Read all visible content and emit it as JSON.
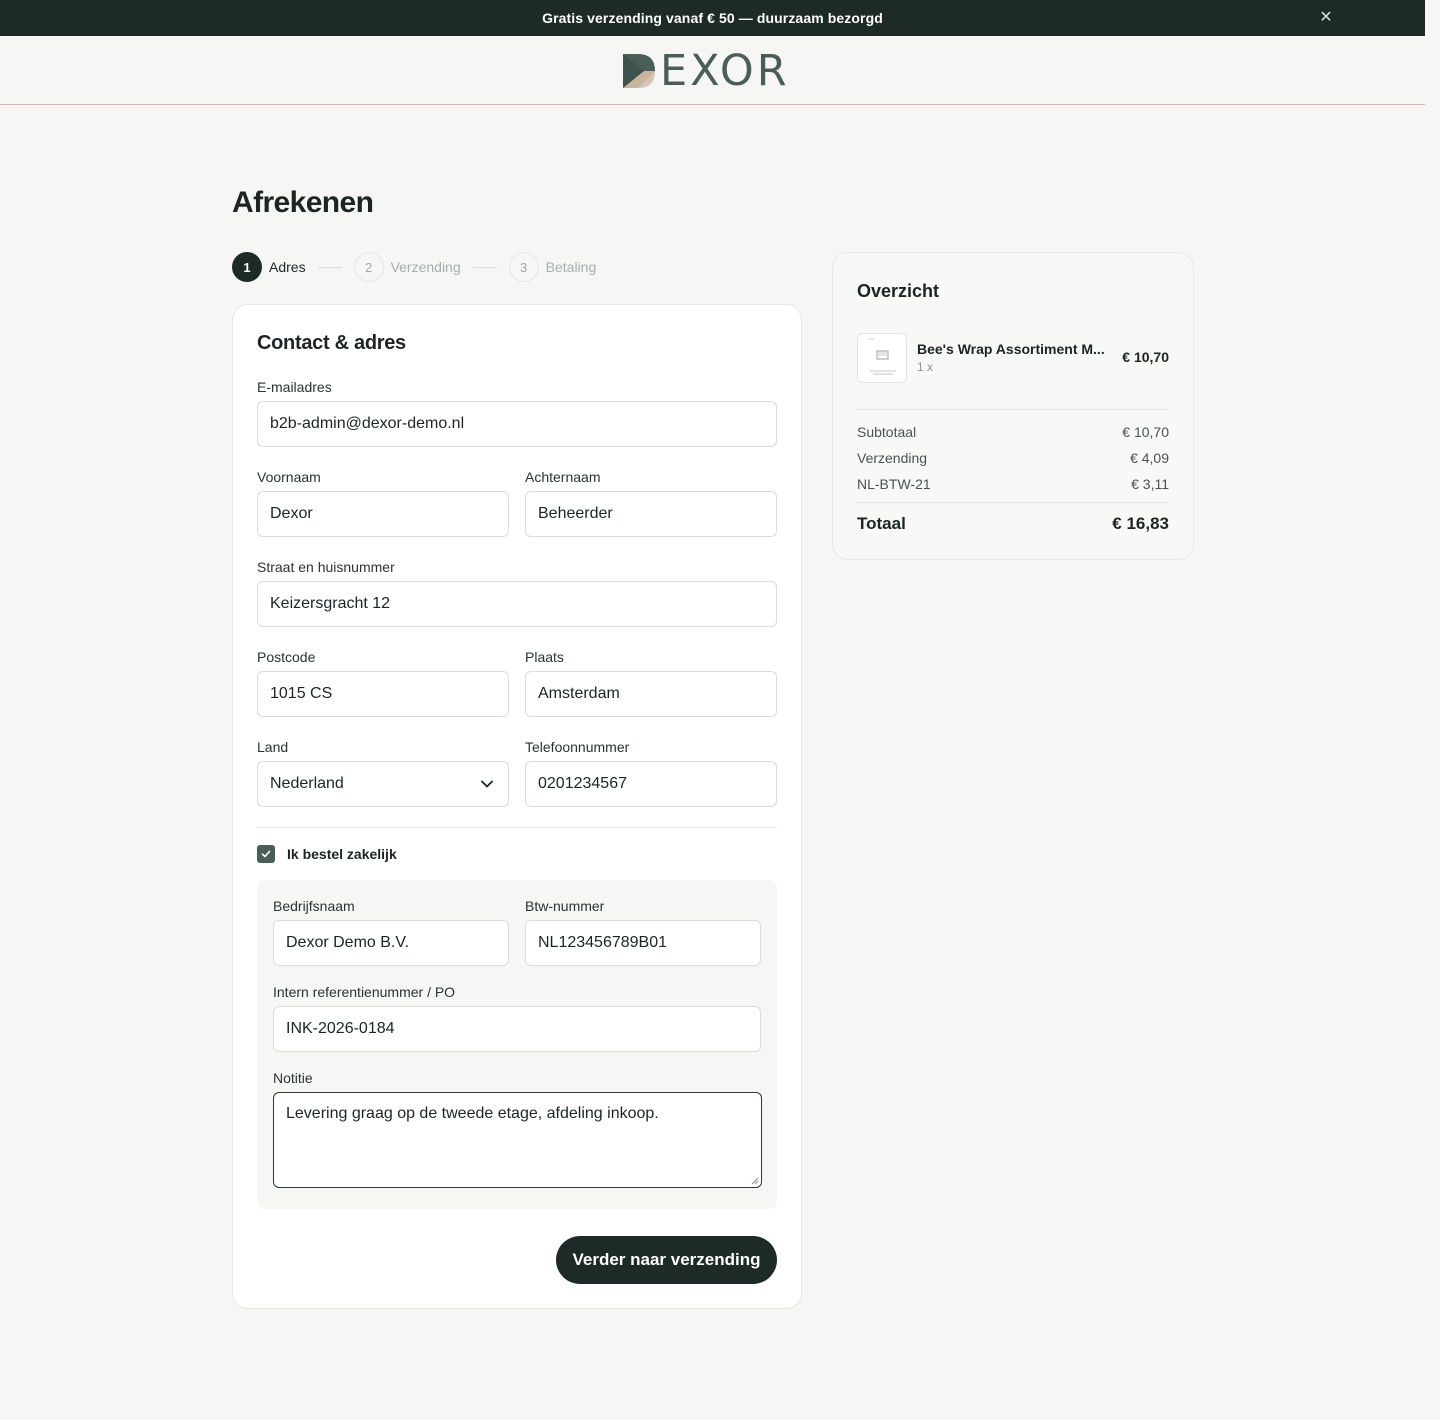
{
  "promo": {
    "text": "Gratis verzending vanaf € 50 — duurzaam bezorgd",
    "close_icon": "close-icon"
  },
  "brand": {
    "logo_text": "EXOR"
  },
  "page": {
    "title": "Afrekenen"
  },
  "steps": [
    {
      "number": "1",
      "label": "Adres",
      "active": true
    },
    {
      "number": "2",
      "label": "Verzending",
      "active": false
    },
    {
      "number": "3",
      "label": "Betaling",
      "active": false
    }
  ],
  "form": {
    "title": "Contact & adres",
    "email": {
      "label": "E-mailadres",
      "value": "b2b-admin@dexor-demo.nl"
    },
    "first_name": {
      "label": "Voornaam",
      "value": "Dexor"
    },
    "last_name": {
      "label": "Achternaam",
      "value": "Beheerder"
    },
    "street": {
      "label": "Straat en huisnummer",
      "value": "Keizersgracht 12"
    },
    "postcode": {
      "label": "Postcode",
      "value": "1015 CS"
    },
    "city": {
      "label": "Plaats",
      "value": "Amsterdam"
    },
    "country": {
      "label": "Land",
      "value": "Nederland"
    },
    "phone": {
      "label": "Telefoonnummer",
      "value": "0201234567"
    },
    "business_checkbox": {
      "label": "Ik bestel zakelijk",
      "checked": true
    },
    "company": {
      "label": "Bedrijfsnaam",
      "value": "Dexor Demo B.V."
    },
    "vat": {
      "label": "Btw-nummer",
      "value": "NL123456789B01"
    },
    "reference": {
      "label": "Intern referentienummer / PO",
      "value": "INK-2026-0184"
    },
    "note": {
      "label": "Notitie",
      "value": "Levering graag op de tweede etage, afdeling inkoop."
    },
    "submit_label": "Verder naar verzending"
  },
  "summary": {
    "title": "Overzicht",
    "item": {
      "name": "Bee's Wrap Assortiment M...",
      "qty": "1 x",
      "price": "€ 10,70"
    },
    "rows": [
      {
        "label": "Subtotaal",
        "value": "€ 10,70"
      },
      {
        "label": "Verzending",
        "value": "€ 4,09"
      },
      {
        "label": "NL-BTW-21",
        "value": "€ 3,11"
      }
    ],
    "total": {
      "label": "Totaal",
      "value": "€ 16,83"
    }
  },
  "colors": {
    "dark": "#1e2a28",
    "accent": "#4a5e59",
    "header_rule": "#d9b7a3",
    "background": "#f6f6f5"
  }
}
